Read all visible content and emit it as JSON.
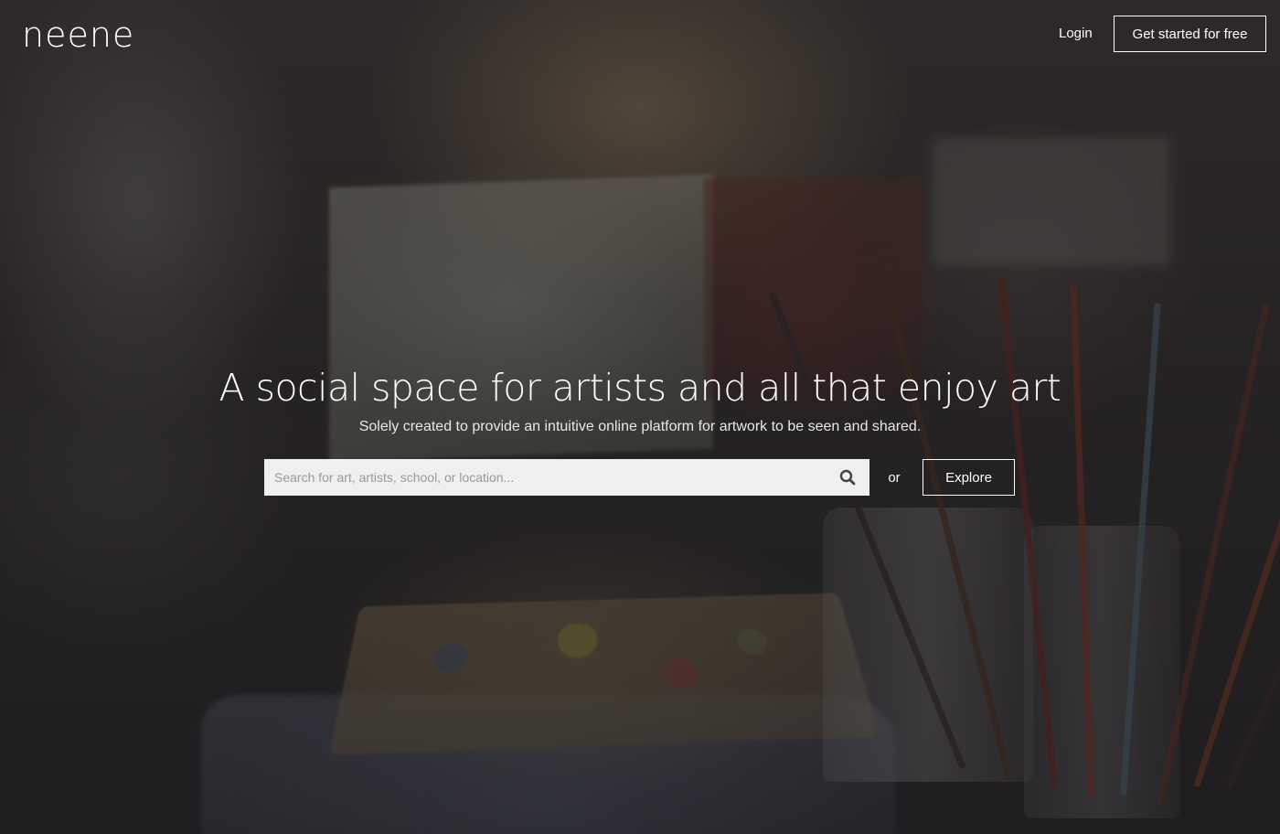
{
  "header": {
    "logo": "neene",
    "login_label": "Login",
    "cta_label": "Get started for free"
  },
  "hero": {
    "headline": "A social space for artists and all that enjoy art",
    "subheadline": "Solely created to provide an intuitive online platform for artwork to be seen and shared.",
    "background_image": "art-studio-palette-brushes"
  },
  "search": {
    "placeholder": "Search for art, artists, school, or location...",
    "value": "",
    "icon": "search-icon",
    "or_label": "or",
    "explore_label": "Explore"
  },
  "colors": {
    "text": "#ffffff",
    "search_bg": "#efefef",
    "overlay": "rgba(20,18,22,0.52)"
  }
}
